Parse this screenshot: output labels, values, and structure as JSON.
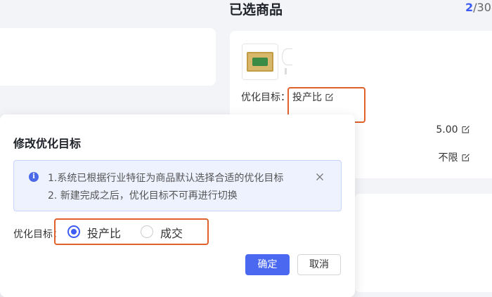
{
  "selected_panel": {
    "title": "已选商品",
    "count_current": "2",
    "count_total": "/30",
    "goal_label": "优化目标：",
    "goal_value": "投产比",
    "bid_value": "5.00",
    "limit_value": "不限"
  },
  "modal": {
    "title": "修改优化目标",
    "alert_line1": "1.系统已根据行业特征为商品默认选择合适的优化目标",
    "alert_line2": "2. 新建完成之后，优化目标不可再进行切换",
    "goal_label": "优化目标：",
    "options": [
      "投产比",
      "成交"
    ],
    "selected_option": "投产比",
    "confirm_label": "确定",
    "cancel_label": "取消"
  },
  "colors": {
    "accent": "#3d5bf5",
    "highlight_box": "#e0612a",
    "alert_bg": "#eef2ff"
  },
  "icons": [
    "edit-icon",
    "info-icon",
    "close-icon"
  ]
}
